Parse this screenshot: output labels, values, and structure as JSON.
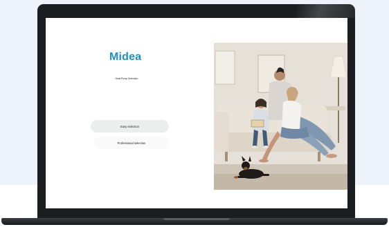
{
  "app": {
    "logo_text": "Midea",
    "subtitle": "Heat Pump Selection"
  },
  "buttons": {
    "easy_label": "Easy selection",
    "professional_label": "Professional selection"
  },
  "colors": {
    "brand": "#1f8fc7",
    "background": "#eef2fa",
    "laptop_frame": "#1c1d20"
  }
}
